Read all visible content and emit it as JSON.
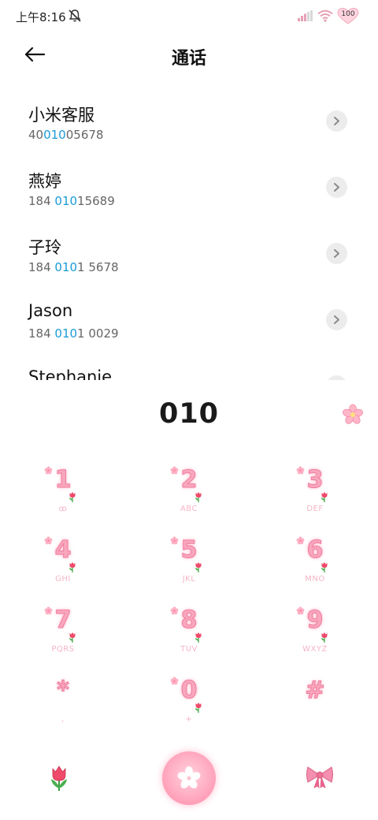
{
  "status_bar": {
    "time": "上午8:16",
    "battery": "100"
  },
  "header": {
    "back_icon": "arrow-left-icon",
    "title": "通话"
  },
  "contacts": [
    {
      "name": "小米客服",
      "number_prefix": "40",
      "number_match": "010",
      "number_suffix": "05678"
    },
    {
      "name": "燕婷",
      "number_prefix": "184 ",
      "number_match": "010",
      "number_suffix": "15689"
    },
    {
      "name": "子玲",
      "number_prefix": "184 ",
      "number_match": "010",
      "number_suffix": "1 5678"
    },
    {
      "name": "Jason",
      "number_prefix": "184 ",
      "number_match": "010",
      "number_suffix": "1 0029"
    },
    {
      "name": "Stephanie",
      "number_prefix": "",
      "number_match": "",
      "number_suffix": ""
    }
  ],
  "dialer": {
    "input": "010",
    "highlight_color": "#1a9bd7",
    "key_color": "#f8a7bd"
  },
  "keys": [
    {
      "digit": "1",
      "letters": "ꝏ"
    },
    {
      "digit": "2",
      "letters": "ABC"
    },
    {
      "digit": "3",
      "letters": "DEF"
    },
    {
      "digit": "4",
      "letters": "GHI"
    },
    {
      "digit": "5",
      "letters": "JKL"
    },
    {
      "digit": "6",
      "letters": "MNO"
    },
    {
      "digit": "7",
      "letters": "PQRS"
    },
    {
      "digit": "8",
      "letters": "TUV"
    },
    {
      "digit": "9",
      "letters": "WXYZ"
    },
    {
      "digit": "*",
      "letters": ","
    },
    {
      "digit": "0",
      "letters": "+"
    },
    {
      "digit": "#",
      "letters": ""
    }
  ],
  "bottom_bar": {
    "left_icon": "tulip-icon",
    "call_icon": "cherry-blossom-icon",
    "right_icon": "ribbon-bow-icon"
  }
}
